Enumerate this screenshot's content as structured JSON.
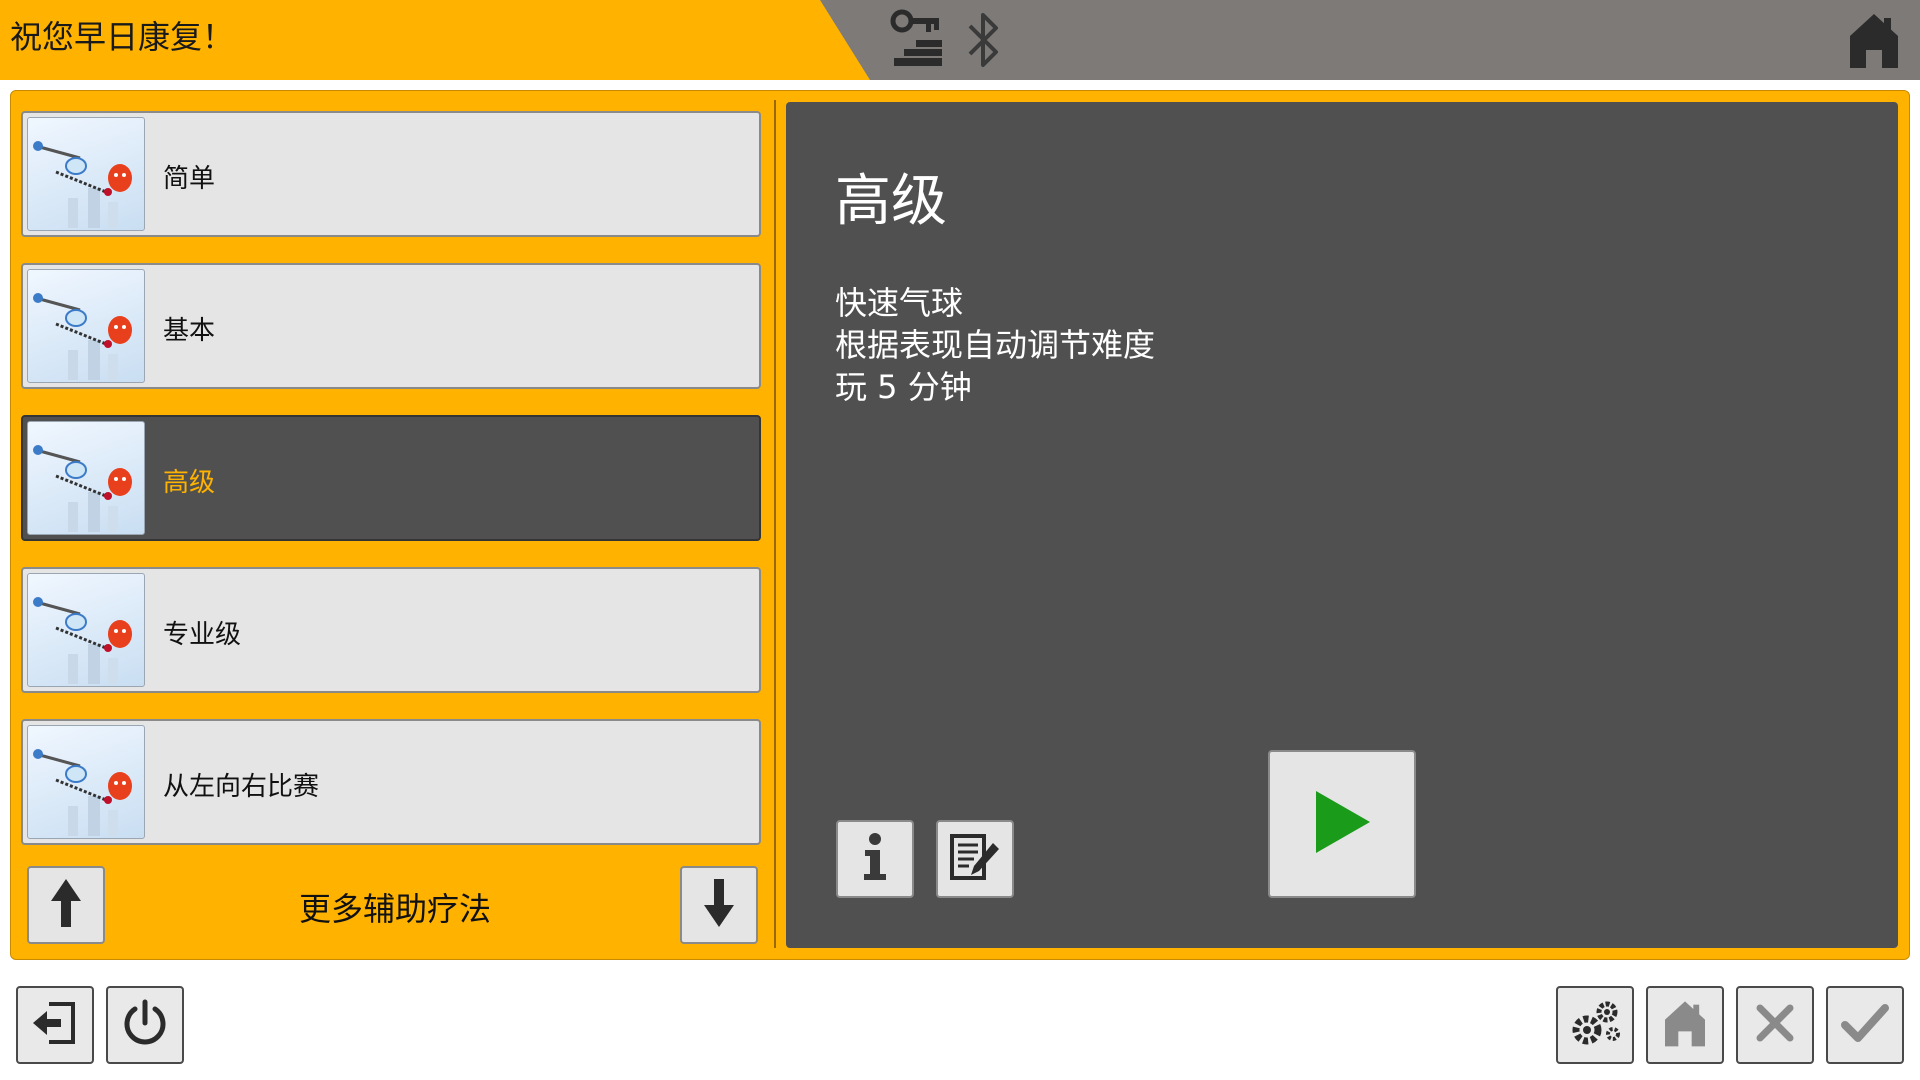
{
  "header": {
    "greeting": "祝您早日康复！",
    "icons": [
      "key-stairs-icon",
      "bluetooth-icon",
      "home-icon"
    ]
  },
  "list": {
    "items": [
      {
        "label": "简单",
        "selected": false
      },
      {
        "label": "基本",
        "selected": false
      },
      {
        "label": "高级",
        "selected": true
      },
      {
        "label": "专业级",
        "selected": false
      },
      {
        "label": "从左向右比赛",
        "selected": false
      }
    ],
    "more_label": "更多辅助疗法",
    "thumbnail_icon": "helicopter-balloon-game-icon"
  },
  "detail": {
    "title": "高级",
    "lines": [
      "快速气球",
      "根据表现自动调节难度",
      "玩 5 分钟"
    ],
    "buttons": [
      "info-icon",
      "edit-notes-icon",
      "play-icon"
    ]
  },
  "bottom": {
    "left_buttons": [
      "logout-icon",
      "power-icon"
    ],
    "right_buttons": [
      "settings-gears-icon",
      "home-icon",
      "close-icon",
      "check-icon"
    ]
  },
  "colors": {
    "accent": "#FFB300",
    "panel": "#505050",
    "header_gray": "#7d7a78",
    "play_green": "#1a9c1a"
  }
}
